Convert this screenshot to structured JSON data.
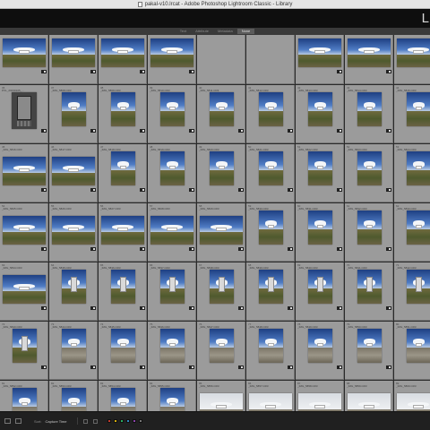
{
  "window": {
    "title": "pakal-v10.lrcat - Adobe Photoshop Lightroom Classic - Library"
  },
  "module": {
    "label": "L"
  },
  "filter_bar": {
    "tabs": [
      {
        "label": "Text",
        "active": false
      },
      {
        "label": "Attribute",
        "active": false
      },
      {
        "label": "Metadata",
        "active": false
      },
      {
        "label": "None",
        "active": true
      }
    ]
  },
  "grid": {
    "cells": [
      {
        "num": "",
        "name": "",
        "kind": "landscape",
        "scene": "grass"
      },
      {
        "num": "",
        "name": "",
        "kind": "landscape",
        "scene": "grass"
      },
      {
        "num": "",
        "name": "",
        "kind": "landscape",
        "scene": "grass"
      },
      {
        "num": "",
        "name": "",
        "kind": "landscape",
        "scene": "grass"
      },
      {
        "num": "",
        "name": "",
        "kind": "none",
        "scene": ""
      },
      {
        "num": "",
        "name": "",
        "kind": "none",
        "scene": ""
      },
      {
        "num": "",
        "name": "",
        "kind": "landscape",
        "scene": "grass"
      },
      {
        "num": "",
        "name": "",
        "kind": "landscape",
        "scene": "grass"
      },
      {
        "num": "",
        "name": "",
        "kind": "landscape",
        "scene": "grass"
      },
      {
        "num": "36",
        "name": "PXL_20230105_...",
        "kind": "phone",
        "scene": "phone"
      },
      {
        "num": "37",
        "name": "_IMG_5808.CR3",
        "kind": "portrait",
        "scene": "grass"
      },
      {
        "num": "38",
        "name": "_IMG_5809.CR3",
        "kind": "portrait",
        "scene": "grass"
      },
      {
        "num": "39",
        "name": "_IMG_5810.CR3",
        "kind": "portrait",
        "scene": "grass"
      },
      {
        "num": "40",
        "name": "_IMG_5811.CR3",
        "kind": "portrait",
        "scene": "grass"
      },
      {
        "num": "41",
        "name": "_IMG_5812.CR3",
        "kind": "portrait",
        "scene": "grass"
      },
      {
        "num": "42",
        "name": "_IMG_5813.CR3",
        "kind": "portrait",
        "scene": "grass"
      },
      {
        "num": "43",
        "name": "_IMG_5814.CR3",
        "kind": "portrait",
        "scene": "grass"
      },
      {
        "num": "44",
        "name": "_IMG_5815.CR3",
        "kind": "portrait",
        "scene": "grass"
      },
      {
        "num": "45",
        "name": "_IMG_5816.CR3",
        "kind": "landscape",
        "scene": "grass"
      },
      {
        "num": "46",
        "name": "_IMG_5817.CR3",
        "kind": "landscape",
        "scene": "grass"
      },
      {
        "num": "47",
        "name": "_IMG_5818.CR3",
        "kind": "portrait",
        "scene": "grass"
      },
      {
        "num": "48",
        "name": "_IMG_5819.CR3",
        "kind": "portrait",
        "scene": "grass"
      },
      {
        "num": "49",
        "name": "_IMG_5820.CR3",
        "kind": "portrait",
        "scene": "grass"
      },
      {
        "num": "50",
        "name": "_IMG_5821.CR3",
        "kind": "portrait",
        "scene": "grass"
      },
      {
        "num": "51",
        "name": "_IMG_5822.CR3",
        "kind": "portrait",
        "scene": "grass"
      },
      {
        "num": "52",
        "name": "_IMG_5823.CR3",
        "kind": "portrait",
        "scene": "grass"
      },
      {
        "num": "53",
        "name": "_IMG_5824.CR3",
        "kind": "portrait",
        "scene": "grass"
      },
      {
        "num": "54",
        "name": "_IMG_5825.CR3",
        "kind": "landscape",
        "scene": "grass"
      },
      {
        "num": "55",
        "name": "_IMG_5826.CR3",
        "kind": "landscape",
        "scene": "grass"
      },
      {
        "num": "56",
        "name": "_IMG_5827.CR3",
        "kind": "landscape",
        "scene": "grass"
      },
      {
        "num": "57",
        "name": "_IMG_5828.CR3",
        "kind": "landscape",
        "scene": "grass"
      },
      {
        "num": "58",
        "name": "_IMG_5829.CR3",
        "kind": "landscape",
        "scene": "grass"
      },
      {
        "num": "59",
        "name": "_IMG_5830.CR3",
        "kind": "portrait",
        "scene": "grass"
      },
      {
        "num": "60",
        "name": "_IMG_5831.CR3",
        "kind": "portrait",
        "scene": "grass"
      },
      {
        "num": "61",
        "name": "_IMG_5832.CR3",
        "kind": "portrait",
        "scene": "grass"
      },
      {
        "num": "62",
        "name": "_IMG_5833.CR3",
        "kind": "portrait",
        "scene": "grass"
      },
      {
        "num": "63",
        "name": "_IMG_5834.CR3",
        "kind": "landscape",
        "scene": "grass"
      },
      {
        "num": "64",
        "name": "_IMG_5835.CR3",
        "kind": "portrait",
        "scene": "tower"
      },
      {
        "num": "65",
        "name": "_IMG_5836.CR3",
        "kind": "portrait",
        "scene": "tower"
      },
      {
        "num": "66",
        "name": "_IMG_5837.CR3",
        "kind": "portrait",
        "scene": "tower"
      },
      {
        "num": "67",
        "name": "_IMG_5838.CR3",
        "kind": "portrait",
        "scene": "tower"
      },
      {
        "num": "68",
        "name": "_IMG_5839.CR3",
        "kind": "portrait",
        "scene": "tower"
      },
      {
        "num": "69",
        "name": "_IMG_5840.CR3",
        "kind": "portrait",
        "scene": "tower"
      },
      {
        "num": "70",
        "name": "_IMG_5841.CR3",
        "kind": "portrait",
        "scene": "tower"
      },
      {
        "num": "71",
        "name": "_IMG_5842.CR3",
        "kind": "portrait",
        "scene": "tower"
      },
      {
        "num": "72",
        "name": "_IMG_5843.CR3",
        "kind": "portrait",
        "scene": "tower"
      },
      {
        "num": "73",
        "name": "_IMG_5844.CR3",
        "kind": "portrait",
        "scene": "gravel"
      },
      {
        "num": "74",
        "name": "_IMG_5845.CR3",
        "kind": "portrait",
        "scene": "gravel"
      },
      {
        "num": "75",
        "name": "_IMG_5846.CR3",
        "kind": "portrait",
        "scene": "gravel"
      },
      {
        "num": "76",
        "name": "_IMG_5847.CR3",
        "kind": "portrait",
        "scene": "gravel"
      },
      {
        "num": "77",
        "name": "_IMG_5848.CR3",
        "kind": "portrait",
        "scene": "gravel"
      },
      {
        "num": "78",
        "name": "_IMG_5849.CR3",
        "kind": "portrait",
        "scene": "gravel"
      },
      {
        "num": "79",
        "name": "_IMG_5850.CR3",
        "kind": "portrait",
        "scene": "gravel"
      },
      {
        "num": "80",
        "name": "_IMG_5851.CR3",
        "kind": "portrait",
        "scene": "gravel"
      },
      {
        "num": "81",
        "name": "_IMG_5852.CR3",
        "kind": "portrait",
        "scene": "gravel"
      },
      {
        "num": "82",
        "name": "_IMG_5853.CR3",
        "kind": "portrait",
        "scene": "gravel"
      },
      {
        "num": "83",
        "name": "_IMG_5854.CR3",
        "kind": "portrait",
        "scene": "gravel"
      },
      {
        "num": "84",
        "name": "_IMG_5855.CR3",
        "kind": "portrait",
        "scene": "gravel"
      },
      {
        "num": "85",
        "name": "_IMG_5856.CR3",
        "kind": "landscape",
        "scene": "overcast"
      },
      {
        "num": "86",
        "name": "_IMG_5857.CR3",
        "kind": "landscape",
        "scene": "overcast"
      },
      {
        "num": "87",
        "name": "_IMG_5858.CR3",
        "kind": "landscape",
        "scene": "overcast"
      },
      {
        "num": "88",
        "name": "_IMG_5859.CR3",
        "kind": "landscape",
        "scene": "overcast"
      },
      {
        "num": "89",
        "name": "_IMG_5860.CR3",
        "kind": "landscape",
        "scene": "overcast"
      }
    ]
  },
  "toolbar": {
    "sort_label": "Sort:",
    "sort_value": "Capture Time",
    "color_labels": [
      "#c0392b",
      "#d4ac0d",
      "#27ae60",
      "#2e86c1",
      "#8e44ad",
      "#777777"
    ]
  }
}
